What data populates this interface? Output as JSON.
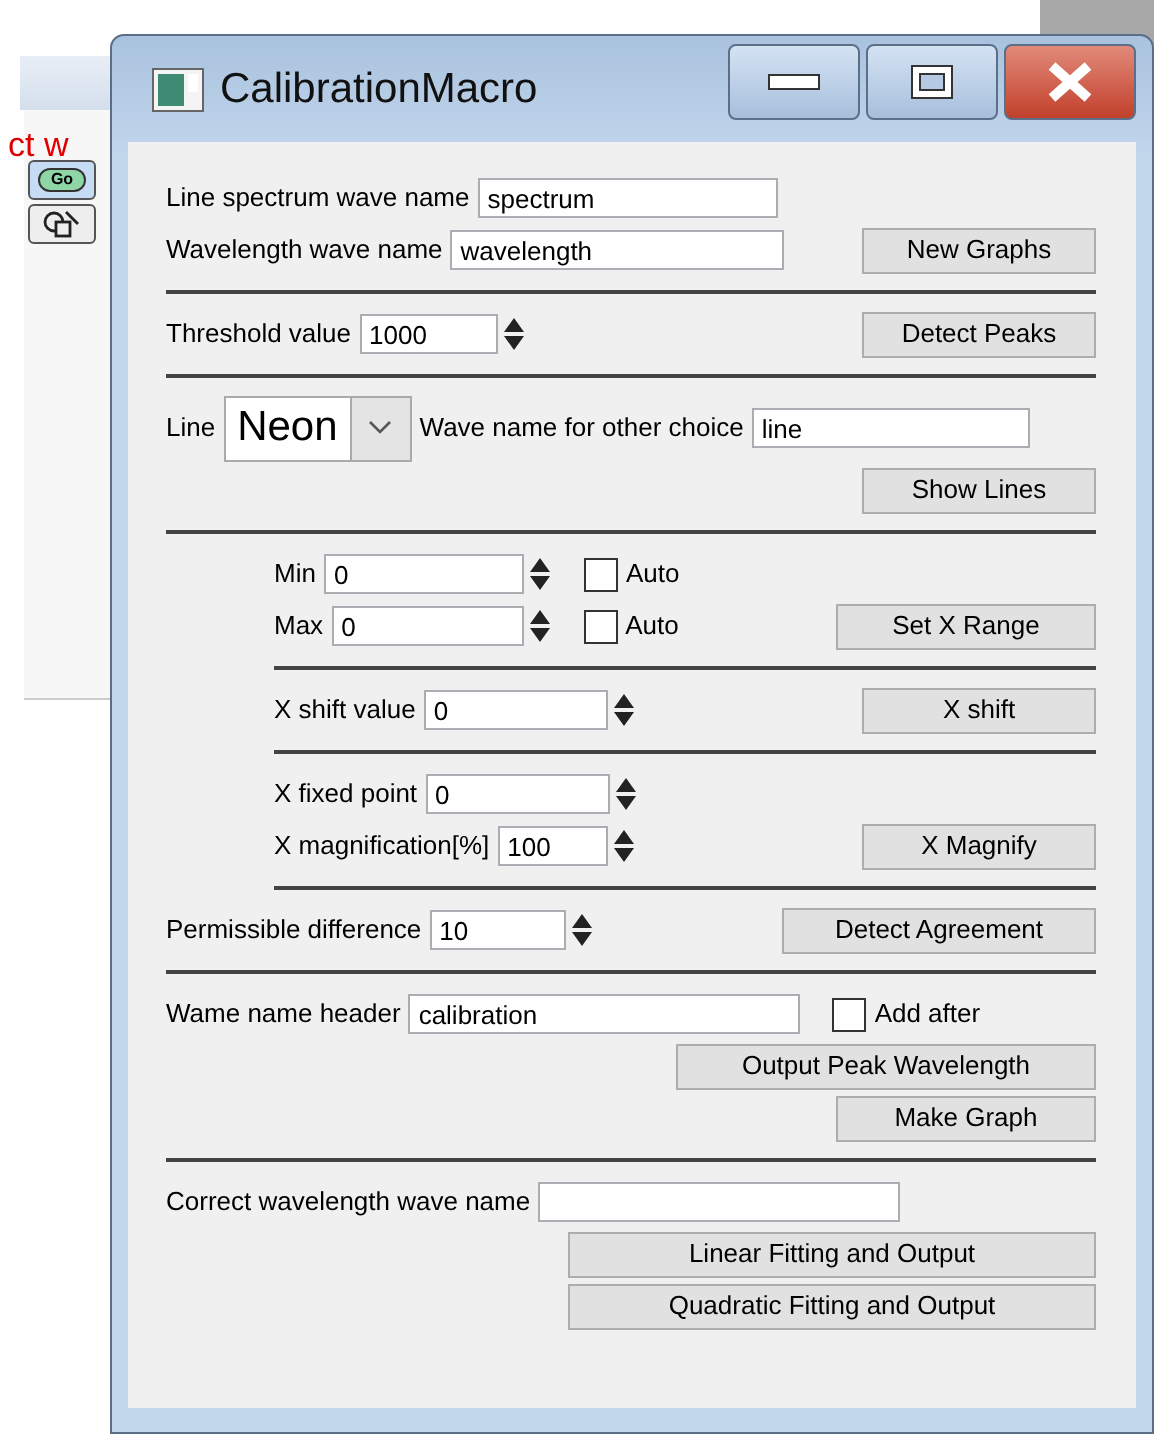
{
  "background": {
    "cut_text": "ct w",
    "go_button": "Go"
  },
  "window": {
    "title": "CalibrationMacro"
  },
  "sections": [
    {
      "indented": false,
      "rows": [
        {
          "items": [
            {
              "kind": "label",
              "text": "Line spectrum wave name"
            },
            {
              "kind": "field",
              "value": "spectrum"
            }
          ]
        },
        {
          "items": [
            {
              "kind": "label",
              "text": "Wavelength wave name"
            },
            {
              "kind": "field",
              "value": "wavelength"
            }
          ],
          "button": "New Graphs"
        }
      ]
    },
    {
      "indented": false,
      "rows": [
        {
          "items": [
            {
              "kind": "label",
              "text": "Threshold value"
            },
            {
              "kind": "spin",
              "value": "1000"
            }
          ],
          "button": "Detect Peaks"
        }
      ]
    },
    {
      "indented": false,
      "rows": [
        {
          "items": [
            {
              "kind": "label",
              "text": "Line"
            },
            {
              "kind": "select",
              "value": "Neon"
            },
            {
              "kind": "label",
              "text": "Wave name for other choice"
            },
            {
              "kind": "field",
              "value": "line"
            }
          ]
        },
        {
          "items": [],
          "button": "Show Lines"
        }
      ]
    },
    {
      "indented": true,
      "rows": [
        {
          "items": [
            {
              "kind": "label",
              "text": "Min"
            },
            {
              "kind": "spin",
              "value": "0"
            },
            {
              "kind": "checkbox",
              "label": "Auto",
              "checked": false
            }
          ]
        },
        {
          "items": [
            {
              "kind": "label",
              "text": "Max"
            },
            {
              "kind": "spin",
              "value": "0"
            },
            {
              "kind": "checkbox",
              "label": "Auto",
              "checked": false
            }
          ],
          "button": "Set X Range"
        }
      ]
    },
    {
      "indented": true,
      "rows": [
        {
          "items": [
            {
              "kind": "label",
              "text": "X shift value"
            },
            {
              "kind": "spin",
              "value": "0"
            }
          ],
          "button": "X shift"
        }
      ]
    },
    {
      "indented": true,
      "rows": [
        {
          "items": [
            {
              "kind": "label",
              "text": "X fixed point"
            },
            {
              "kind": "spin",
              "value": "0"
            }
          ]
        },
        {
          "items": [
            {
              "kind": "label",
              "text": "X magnification[%]"
            },
            {
              "kind": "spin",
              "value": "100"
            }
          ],
          "button": "X Magnify"
        }
      ]
    },
    {
      "indented": false,
      "rows": [
        {
          "items": [
            {
              "kind": "label",
              "text": "Permissible difference"
            },
            {
              "kind": "spin",
              "value": "10"
            }
          ],
          "button": "Detect Agreement"
        }
      ]
    },
    {
      "indented": false,
      "rows": [
        {
          "items": [
            {
              "kind": "label",
              "text": "Wame name header"
            },
            {
              "kind": "field",
              "value": "calibration"
            },
            {
              "kind": "checkbox",
              "label": "Add after",
              "checked": false
            }
          ]
        },
        {
          "items": [],
          "button": "Output Peak Wavelength"
        },
        {
          "items": [],
          "button": "Make Graph"
        }
      ]
    },
    {
      "indented": false,
      "rows": [
        {
          "items": [
            {
              "kind": "label",
              "text": "Correct wavelength wave name"
            },
            {
              "kind": "field"
            }
          ]
        },
        {
          "items": [],
          "button": "Linear Fitting and Output"
        },
        {
          "items": [],
          "button": "Quadratic Fitting and Output"
        }
      ]
    }
  ]
}
